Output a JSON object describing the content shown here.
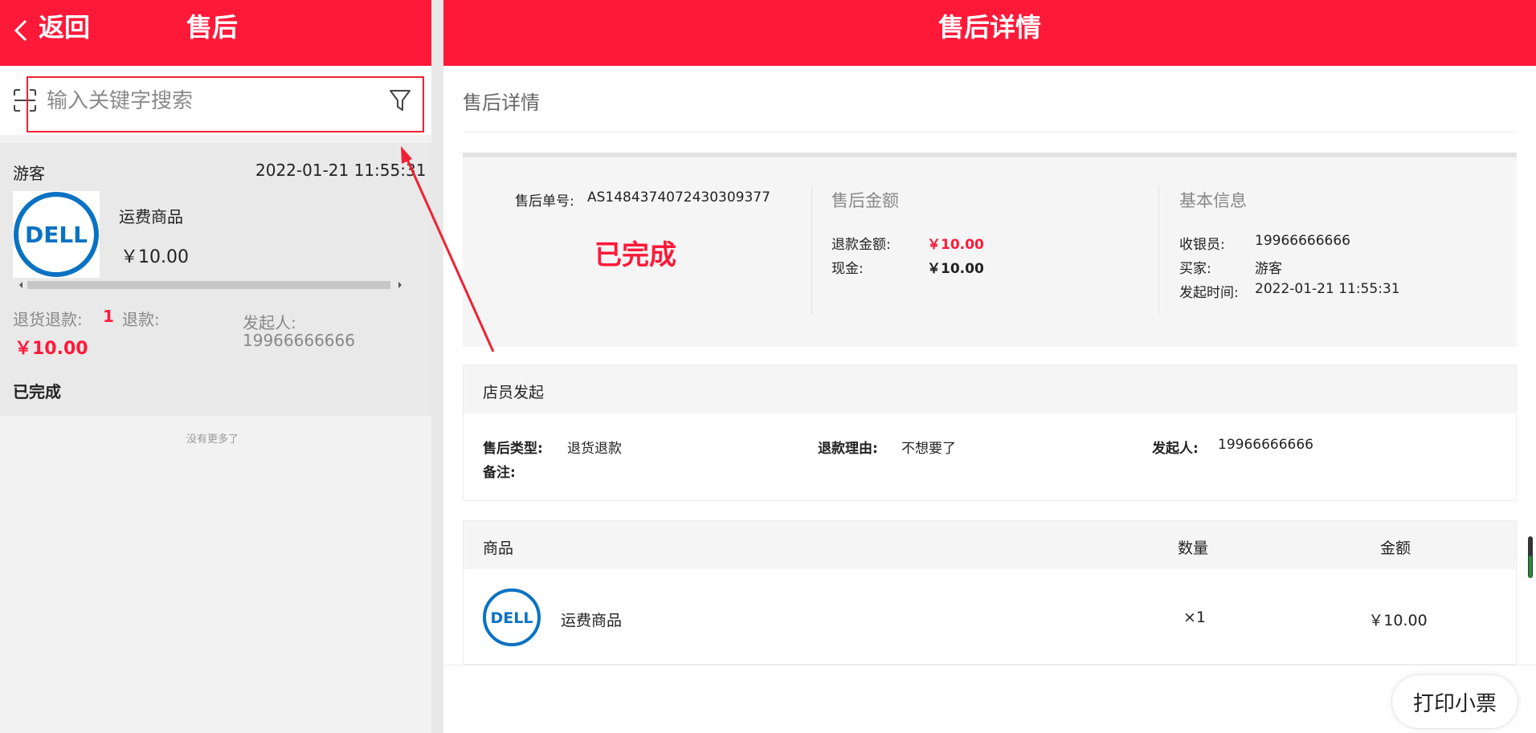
{
  "header": {
    "back_label": "返回",
    "left_title": "售后",
    "right_title": "售后详情"
  },
  "search": {
    "placeholder": "输入关键字搜索"
  },
  "order_card": {
    "customer": "游客",
    "time": "2022-01-21 11:55:31",
    "product_name": "运费商品",
    "product_price": "￥10.00",
    "return_label": "退货退款:",
    "return_count": "1",
    "refund_label": "退款:",
    "refund_value": "￥10.00",
    "initiator_label": "发起人:",
    "initiator_value": "19966666666",
    "status": "已完成"
  },
  "list_footer": "没有更多了",
  "detail": {
    "section_title": "售后详情",
    "order_no_label": "售后单号:",
    "order_no": "AS1484374072430309377",
    "status": "已完成",
    "amount": {
      "title": "售后金额",
      "refund_label": "退款金额:",
      "refund_value": "￥10.00",
      "cash_label": "现金:",
      "cash_value": "￥10.00"
    },
    "basic": {
      "title": "基本信息",
      "cashier_label": "收银员:",
      "cashier_value": "19966666666",
      "buyer_label": "买家:",
      "buyer_value": "游客",
      "time_label": "发起时间:",
      "time_value": "2022-01-21 11:55:31"
    }
  },
  "staff": {
    "title": "店员发起",
    "type_label": "售后类型:",
    "type_value": "退货退款",
    "reason_label": "退款理由:",
    "reason_value": "不想要了",
    "initiator_label": "发起人:",
    "initiator_value": "19966666666",
    "note_label": "备注:"
  },
  "goods": {
    "col_product": "商品",
    "col_qty": "数量",
    "col_amount": "金额",
    "rows": [
      {
        "name": "运费商品",
        "qty": "×1",
        "amount": "￥10.00"
      }
    ]
  },
  "print_label": "打印小票",
  "brand_logo_text": "DELL",
  "colors": {
    "brand_red": "#ff1939",
    "dell_blue": "#0a72c2"
  }
}
